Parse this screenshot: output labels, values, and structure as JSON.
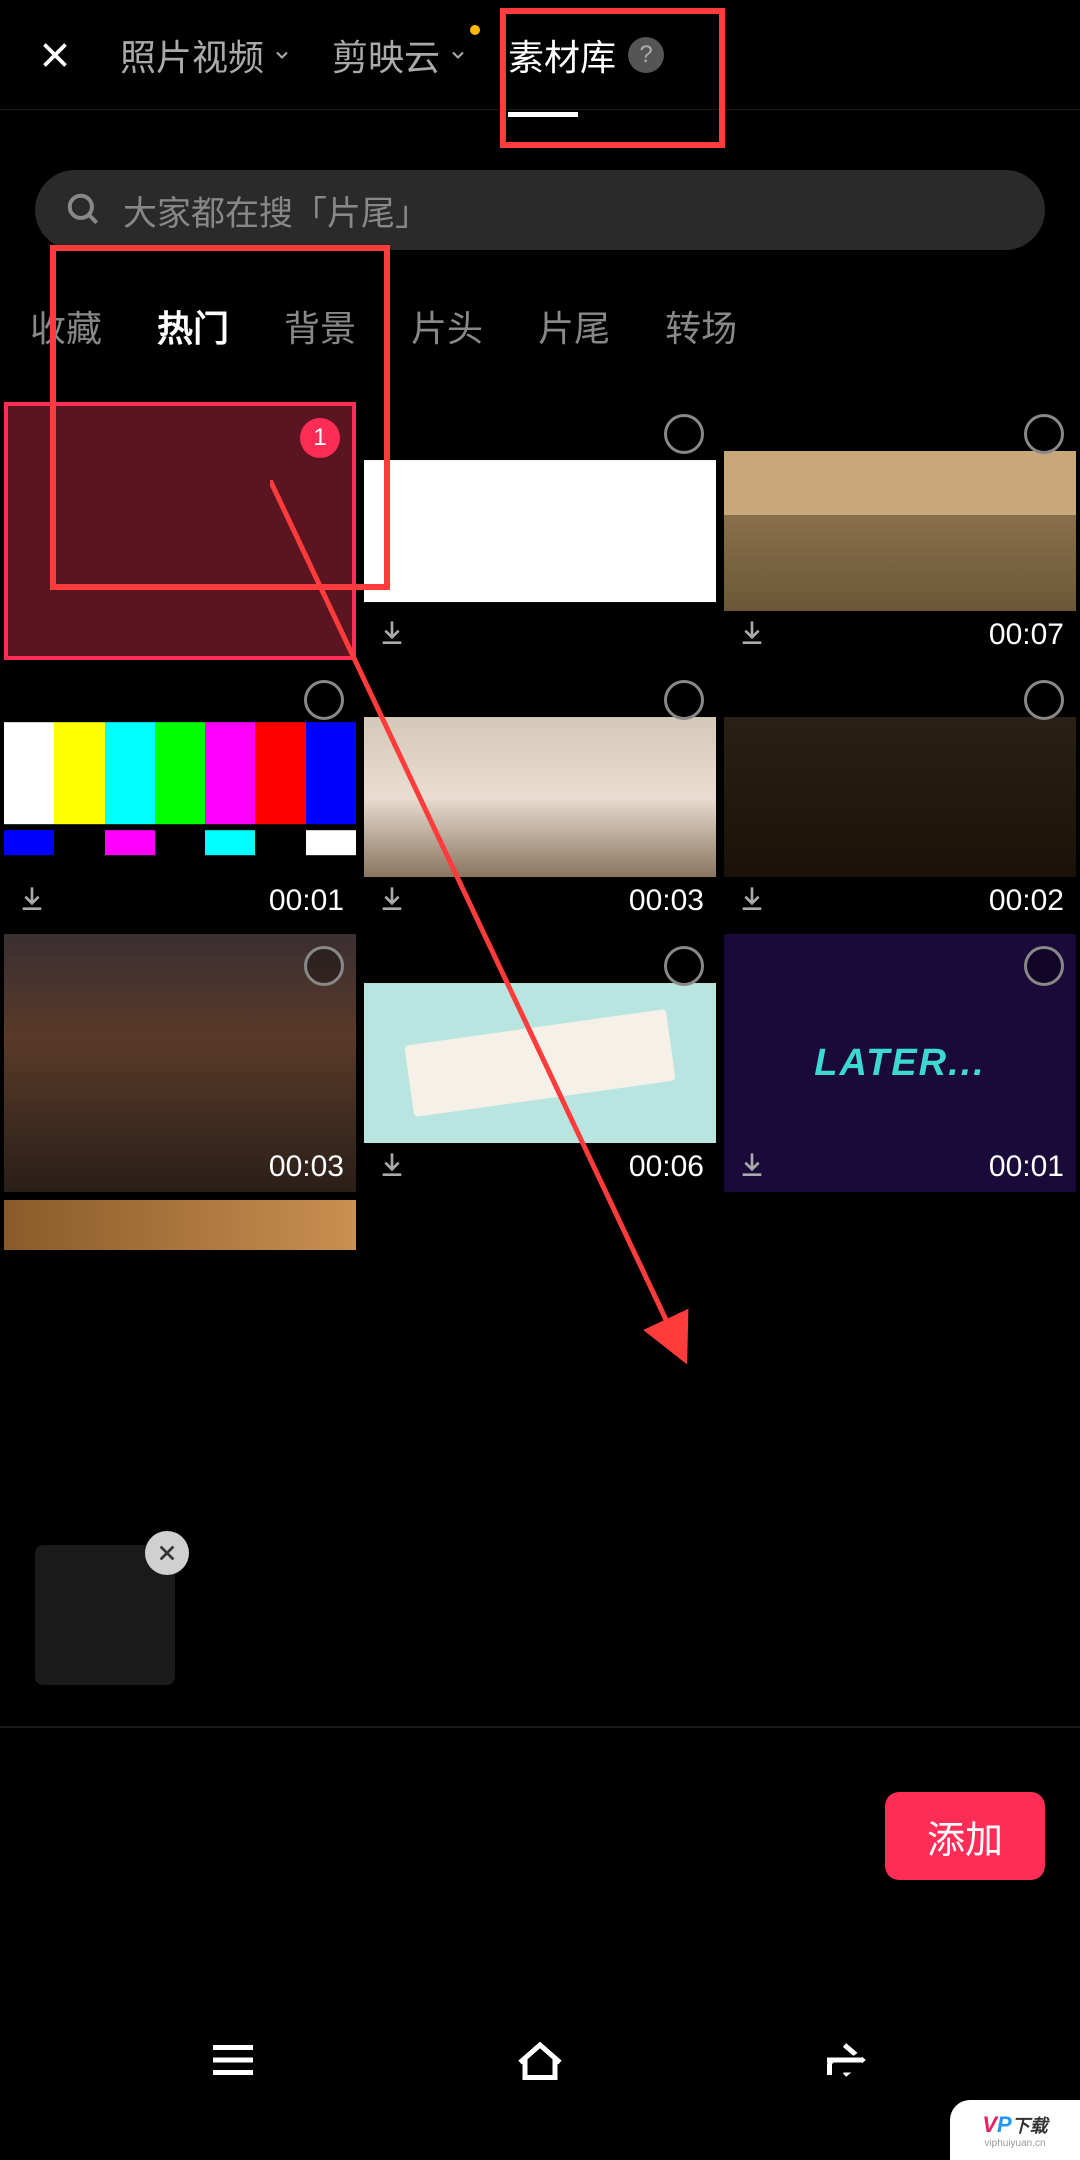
{
  "header": {
    "tabs": {
      "photo_video": "照片视频",
      "jianying_cloud": "剪映云",
      "material_lib": "素材库"
    }
  },
  "search": {
    "placeholder": "大家都在搜「片尾」"
  },
  "categories": {
    "favorites": "收藏",
    "hot": "热门",
    "background": "背景",
    "opening": "片头",
    "ending": "片尾",
    "transition": "转场"
  },
  "items": [
    {
      "type": "maroon",
      "selected": true,
      "badge": "1",
      "duration": "",
      "download": false
    },
    {
      "type": "white",
      "selected": false,
      "duration": "",
      "download": true
    },
    {
      "type": "room",
      "selected": false,
      "duration": "00:07",
      "download": true
    },
    {
      "type": "bars",
      "selected": false,
      "duration": "00:01",
      "download": true
    },
    {
      "type": "face1",
      "selected": false,
      "duration": "00:03",
      "download": true
    },
    {
      "type": "movie",
      "selected": false,
      "duration": "00:02",
      "download": true
    },
    {
      "type": "laugh",
      "selected": false,
      "duration": "00:03",
      "download": false
    },
    {
      "type": "paper",
      "selected": false,
      "duration": "00:06",
      "download": true
    },
    {
      "type": "later",
      "selected": false,
      "duration": "00:01",
      "download": true,
      "text": "LATER..."
    }
  ],
  "buttons": {
    "add": "添加"
  },
  "watermark": {
    "main_v": "V",
    "main_p": "P",
    "main_cn": "下载",
    "sub": "viphuiyuan.cn"
  }
}
